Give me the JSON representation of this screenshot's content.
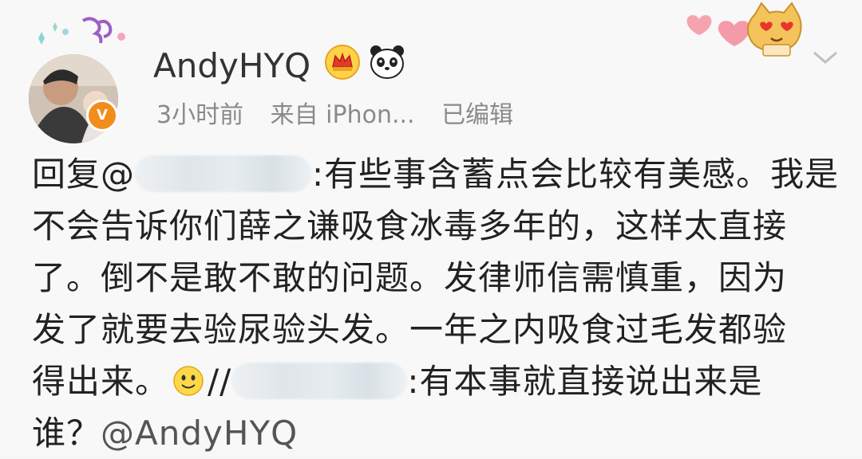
{
  "post": {
    "username": "AndyHYQ",
    "time": "3小时前",
    "source": "来自 iPhon...",
    "edited": "已编辑",
    "verified_mark": "V"
  },
  "body": {
    "line1_prefix": "回复@",
    "line1_suffix": ":有些事含蓄点会比较有美感。我是",
    "line2": "不会告诉你们薛之谦吸食冰毒多年的，这样太直接",
    "line3": "了。倒不是敢不敢的问题。发律师信需慎重，因为",
    "line4": "发了就要去验尿验头发。一年之内吸食过毛发都验",
    "line5_prefix": "得出来。",
    "line5_repost": "//",
    "line5_suffix": ":有本事就直接说出来是",
    "line6_prefix": "谁？",
    "line6_mention": "@AndyHYQ"
  },
  "icons": {
    "crown": "crown-icon",
    "panda": "panda-icon",
    "smiley": "smiley-icon",
    "hearts": "hearts-icon",
    "cat": "heart-eyes-cat-icon",
    "chevron": "chevron-down-icon"
  },
  "colors": {
    "verified_badge": "#f28c1a",
    "meta_text": "#8a8a8a",
    "body_text": "#222222"
  }
}
